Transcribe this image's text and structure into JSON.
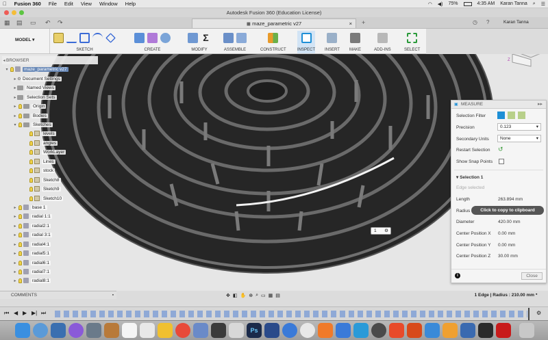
{
  "menubar": {
    "app": "Fusion 360",
    "items": [
      "File",
      "Edit",
      "View",
      "Window",
      "Help"
    ],
    "battery": "75%",
    "time": "4:35 AM",
    "user": "Karan Tanna"
  },
  "window": {
    "title": "Autodesk Fusion 360 (Education License)",
    "tab": "maze_parametric v27",
    "account": "Karan Tanna"
  },
  "toolbar": {
    "workspace": "MODEL",
    "groups": [
      "SKETCH",
      "CREATE",
      "MODIFY",
      "ASSEMBLE",
      "CONSTRUCT",
      "INSPECT",
      "INSERT",
      "MAKE",
      "ADD-INS",
      "SELECT"
    ]
  },
  "browser": {
    "header": "BROWSER",
    "root": "maze_parametric v27",
    "items": [
      "Document Settings",
      "Named Views",
      "Selection Sets",
      "Origin",
      "Bodies",
      "Sketches"
    ],
    "sketches": [
      "levels",
      "angles",
      "WorkLayer",
      "Lines",
      "stock",
      "Sketch8",
      "Sketch9",
      "Sketch10"
    ],
    "components": [
      "base 1",
      "radial 1:1",
      "radial2:1",
      "radial 3:1",
      "radial4:1",
      "radial5:1",
      "radial6:1",
      "radial7:1",
      "radial8:1"
    ]
  },
  "measure": {
    "title": "MEASURE",
    "selection_filter_label": "Selection Filter",
    "precision_label": "Precision",
    "precision_value": "0.123",
    "secondary_units_label": "Secondary Units",
    "secondary_units_value": "None",
    "restart_selection_label": "Restart Selection",
    "show_snap_points_label": "Show Snap Points",
    "selection_header": "Selection 1",
    "edge_selected": "Edge selected",
    "length_label": "Length",
    "length_value": "263.894 mm",
    "radius_label": "Radius",
    "diameter_label": "Diameter",
    "diameter_value": "420.00 mm",
    "cx_label": "Center Position X",
    "cx_value": "0.00 mm",
    "cy_label": "Center Position Y",
    "cy_value": "0.00 mm",
    "cz_label": "Center Position Z",
    "cz_value": "30.00 mm",
    "close_label": "Close",
    "tooltip": "Click to copy to clipboard"
  },
  "viewport": {
    "hud_value": "1"
  },
  "bottom": {
    "comments": "COMMENTS",
    "status": "1 Edge | Radius : 210.00 mm"
  },
  "colors": {
    "accent": "#1e8fd6",
    "maze_dark": "#2b2b2b",
    "maze_wall": "#6f6f6f",
    "panel": "#f5f5f5"
  }
}
